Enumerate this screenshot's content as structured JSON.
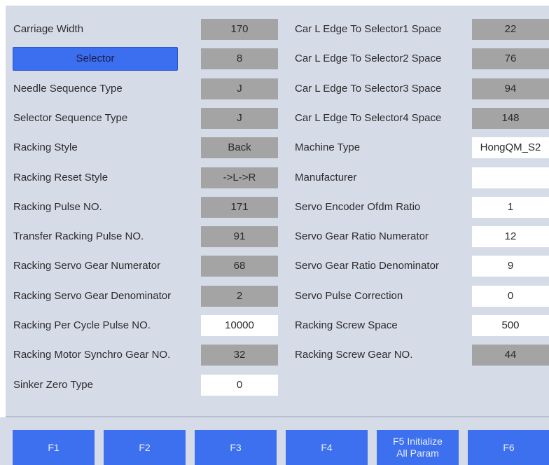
{
  "left": [
    {
      "label": "Carriage Width",
      "value": "170",
      "editable": false
    },
    {
      "label": "Selector",
      "value": "8",
      "editable": false,
      "is_button": true
    },
    {
      "label": "Needle Sequence Type",
      "value": "J",
      "editable": false
    },
    {
      "label": "Selector Sequence Type",
      "value": "J",
      "editable": false
    },
    {
      "label": "Racking Style",
      "value": "Back",
      "editable": false
    },
    {
      "label": "Racking Reset Style",
      "value": "->L->R",
      "editable": false
    },
    {
      "label": "Racking Pulse NO.",
      "value": "171",
      "editable": false
    },
    {
      "label": "Transfer Racking Pulse NO.",
      "value": "91",
      "editable": false
    },
    {
      "label": "Racking Servo  Gear Numerator",
      "value": "68",
      "editable": false
    },
    {
      "label": "Racking Servo Gear Denominator",
      "value": "2",
      "editable": false
    },
    {
      "label": "Racking Per Cycle Pulse NO.",
      "value": "10000",
      "editable": true
    },
    {
      "label": "Racking Motor Synchro Gear NO.",
      "value": "32",
      "editable": false
    },
    {
      "label": "Sinker Zero Type",
      "value": "0",
      "editable": true
    }
  ],
  "right": [
    {
      "label": "Car L Edge To Selector1 Space",
      "value": "22",
      "editable": false
    },
    {
      "label": "Car L Edge To Selector2 Space",
      "value": "76",
      "editable": false
    },
    {
      "label": "Car L Edge To Selector3 Space",
      "value": "94",
      "editable": false
    },
    {
      "label": "Car L Edge To Selector4 Space",
      "value": "148",
      "editable": false
    },
    {
      "label": "Machine Type",
      "value": "HongQM_S2",
      "editable": true
    },
    {
      "label": "Manufacturer",
      "value": "",
      "editable": true
    },
    {
      "label": "Servo Encoder Ofdm Ratio",
      "value": "1",
      "editable": true
    },
    {
      "label": "Servo Gear Ratio Numerator",
      "value": "12",
      "editable": true
    },
    {
      "label": "Servo Gear Ratio Denominator",
      "value": "9",
      "editable": true
    },
    {
      "label": "Servo Pulse Correction",
      "value": "0",
      "editable": true
    },
    {
      "label": "Racking Screw Space",
      "value": "500",
      "editable": true
    },
    {
      "label": "Racking Screw Gear NO.",
      "value": "44",
      "editable": false
    }
  ],
  "function_keys": [
    {
      "line1": "F1",
      "line2": ""
    },
    {
      "line1": "F2",
      "line2": ""
    },
    {
      "line1": "F3",
      "line2": ""
    },
    {
      "line1": "F4",
      "line2": ""
    },
    {
      "line1": "F5 Initialize",
      "line2": "All Param"
    },
    {
      "line1": "F6",
      "line2": ""
    }
  ],
  "colors": {
    "panel_bg": "#d6dbe8",
    "readonly_field": "#a4a4a4",
    "editable_field": "#ffffff",
    "button_blue": "#3d70ee"
  }
}
